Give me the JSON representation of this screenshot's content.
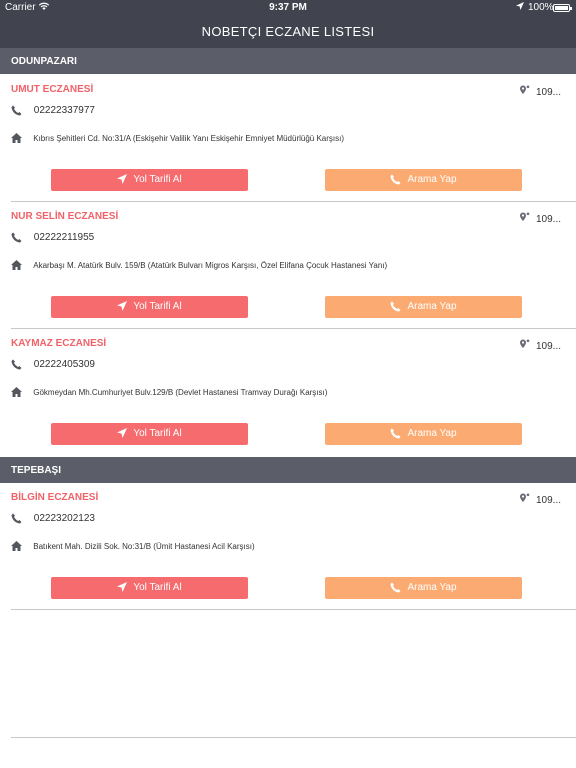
{
  "status": {
    "carrier": "Carrier",
    "time": "9:37 PM",
    "battery": "100%"
  },
  "nav": {
    "title": "NOBETÇI ECZANE LISTESI"
  },
  "sections": [
    {
      "name": "ODUNPAZARI",
      "items": [
        {
          "name": "UMUT ECZANESİ",
          "distance": "109...",
          "phone": "02222337977",
          "address": "Kıbrıs Şehitleri Cd. No:31/A (Eskişehir Valilik Yanı Eskişehir Emniyet Müdürlüğü Karşısı)"
        },
        {
          "name": "NUR SELİN ECZANESİ",
          "distance": "109...",
          "phone": "02222211955",
          "address": "Akarbaşı M. Atatürk Bulv. 159/B (Atatürk Bulvarı Migros Karşısı, Özel Elifana Çocuk Hastanesi Yanı)"
        },
        {
          "name": "KAYMAZ ECZANESİ",
          "distance": "109...",
          "phone": "02222405309",
          "address": "Gökmeydan Mh.Cumhuriyet Bulv.129/B (Devlet Hastanesi Tramvay Durağı Karşısı)"
        }
      ]
    },
    {
      "name": "TEPEBAŞI",
      "items": [
        {
          "name": "BİLGİN ECZANESİ",
          "distance": "109...",
          "phone": "02223202123",
          "address": "Batıkent Mah. Dizili Sok. No:31/B (Ümit Hastanesi Acil Karşısı)"
        }
      ]
    }
  ],
  "buttons": {
    "directions": "Yol Tarifi Al",
    "call": "Arama Yap"
  },
  "colors": {
    "nav_bg": "#41434f",
    "section_bg": "#5b5d69",
    "name": "#f06268",
    "directions_btn": "#f56b6e",
    "call_btn": "#fbab72"
  },
  "icons": {
    "location": "navigation-arrow-icon",
    "pin": "map-pin-icon",
    "phone": "phone-icon",
    "home": "home-icon"
  }
}
